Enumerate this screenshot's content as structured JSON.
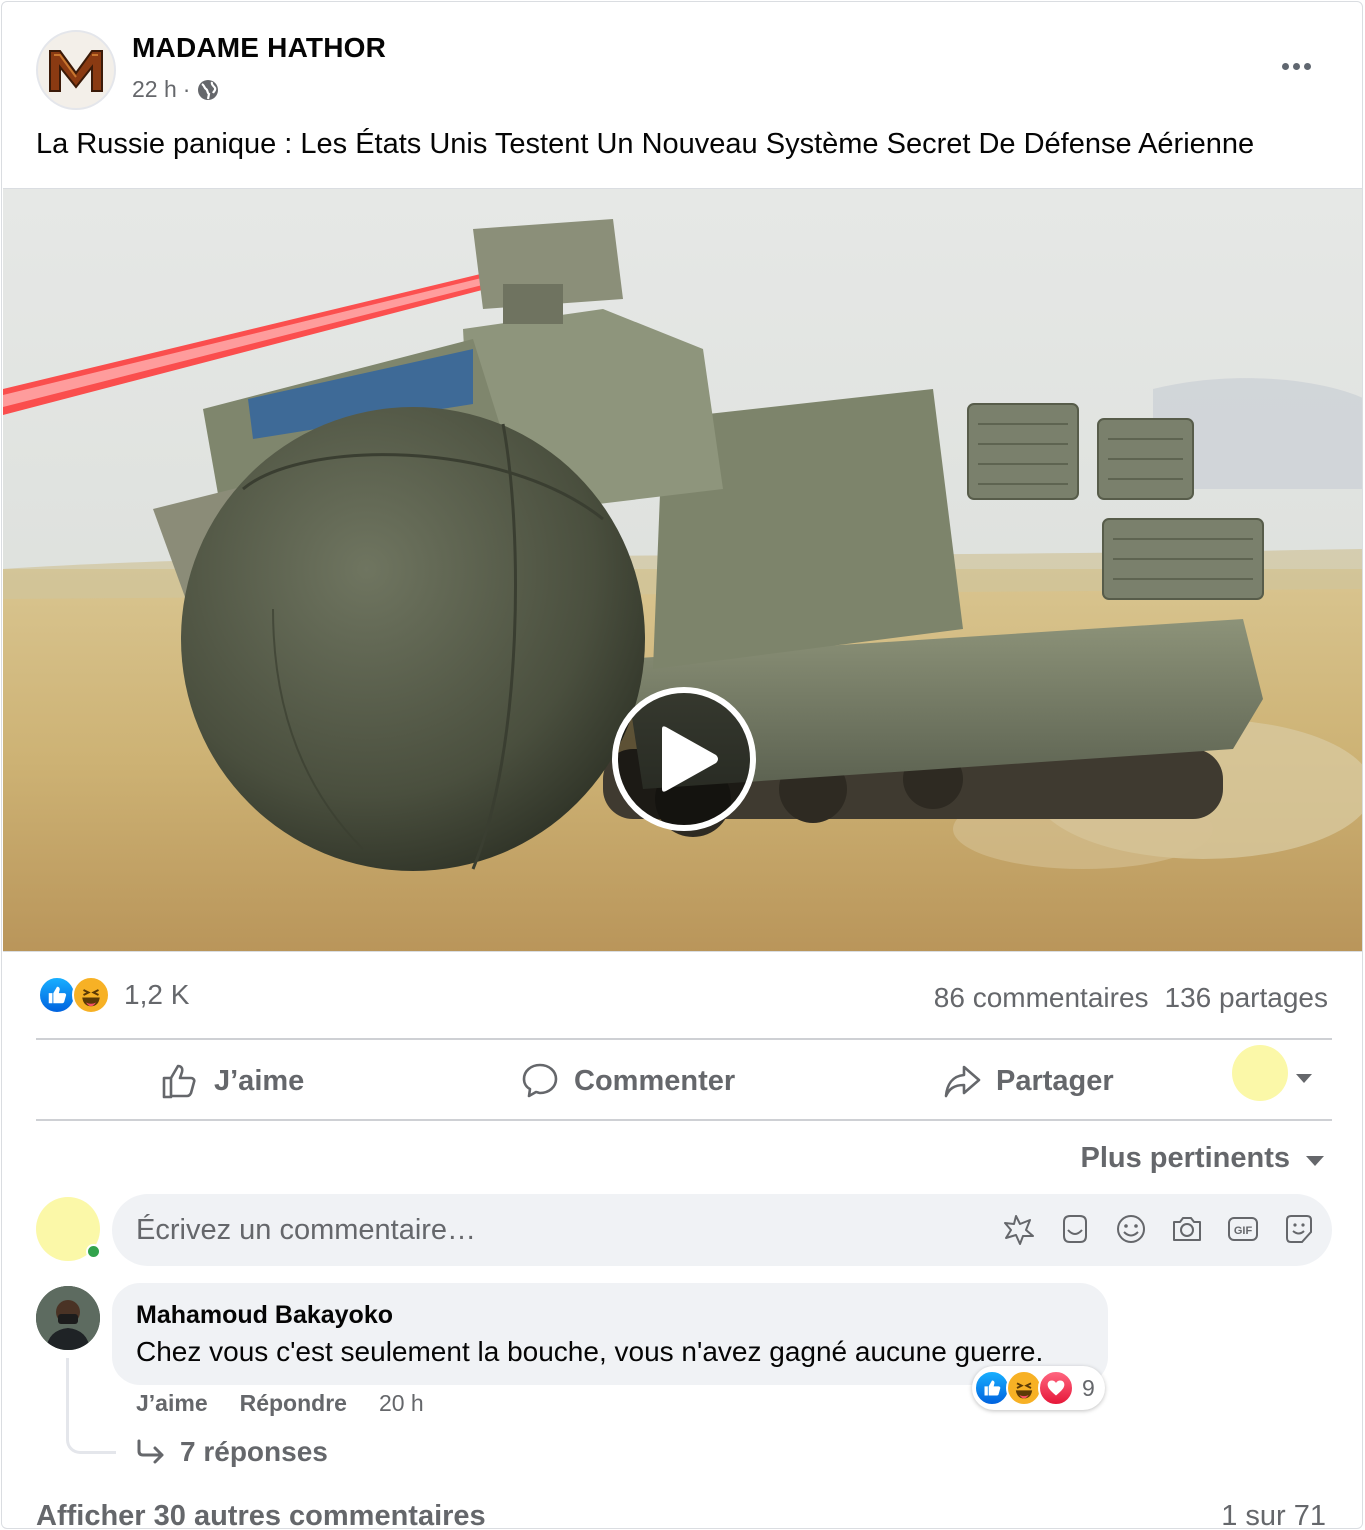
{
  "post": {
    "page_name": "MADAME HATHOR",
    "time": "22 h",
    "separator": "·",
    "privacy_icon": "globe-icon",
    "text": "La Russie panique : Les États Unis Testent Un Nouveau Système Secret De Défense Aérienne",
    "media_type": "video"
  },
  "stats": {
    "reaction_icons": [
      "like-icon",
      "haha-icon"
    ],
    "reaction_count": "1,2 K",
    "comments": "86 commentaires",
    "shares": "136 partages"
  },
  "actions": {
    "like": "J’aime",
    "comment": "Commenter",
    "share": "Partager"
  },
  "sort": {
    "label": "Plus pertinents"
  },
  "composer": {
    "placeholder": "Écrivez un commentaire…",
    "tools": [
      "avatar-sticker-icon",
      "sticker-icon",
      "emoji-icon",
      "camera-icon",
      "gif-icon",
      "sticker-face-icon"
    ]
  },
  "comments": [
    {
      "author": "Mahamoud Bakayoko",
      "text": "Chez vous c'est seulement la bouche, vous n'avez gagné aucune guerre.",
      "reaction_icons": [
        "like-icon",
        "haha-icon",
        "love-icon"
      ],
      "reaction_count": "9",
      "like_label": "J’aime",
      "reply_label": "Répondre",
      "time": "20 h",
      "replies_label": "7 réponses"
    }
  ],
  "footer": {
    "more_comments": "Afficher 30 autres commentaires",
    "pager": "1 sur 71"
  },
  "colors": {
    "secondary_text": "#65676b",
    "bubble_bg": "#f0f2f5",
    "like_blue": "#0866ff",
    "haha_yellow": "#f7b125",
    "love_red": "#f33e58"
  }
}
